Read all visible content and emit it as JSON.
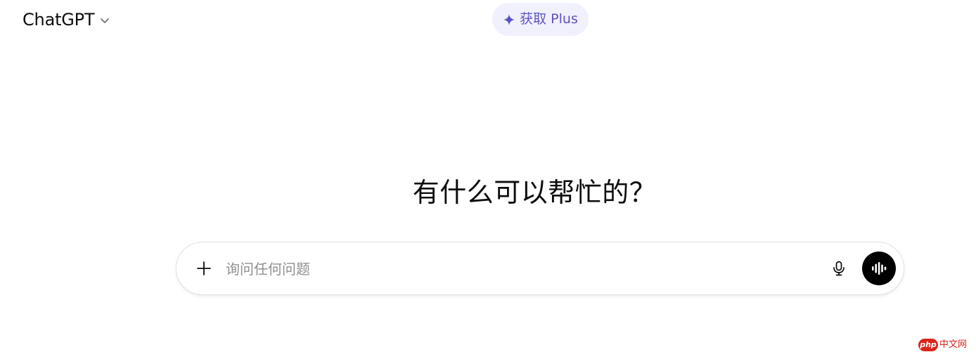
{
  "header": {
    "model_name": "ChatGPT",
    "upgrade_label": "获取 Plus"
  },
  "main": {
    "heading": "有什么可以帮忙的？"
  },
  "composer": {
    "placeholder": "询问任何问题",
    "value": ""
  },
  "watermark": {
    "logo": "php",
    "site": "中文网"
  },
  "icons": {
    "model_chevron": "chevron-down-icon",
    "upgrade": "sparkle-icon",
    "add": "plus-icon",
    "mic": "microphone-icon",
    "voice": "voice-waveform-icon"
  },
  "colors": {
    "upgrade_bg": "#f1f0fd",
    "upgrade_fg": "#5b54c6",
    "voice_button_bg": "#000000",
    "watermark": "#d9251c"
  }
}
